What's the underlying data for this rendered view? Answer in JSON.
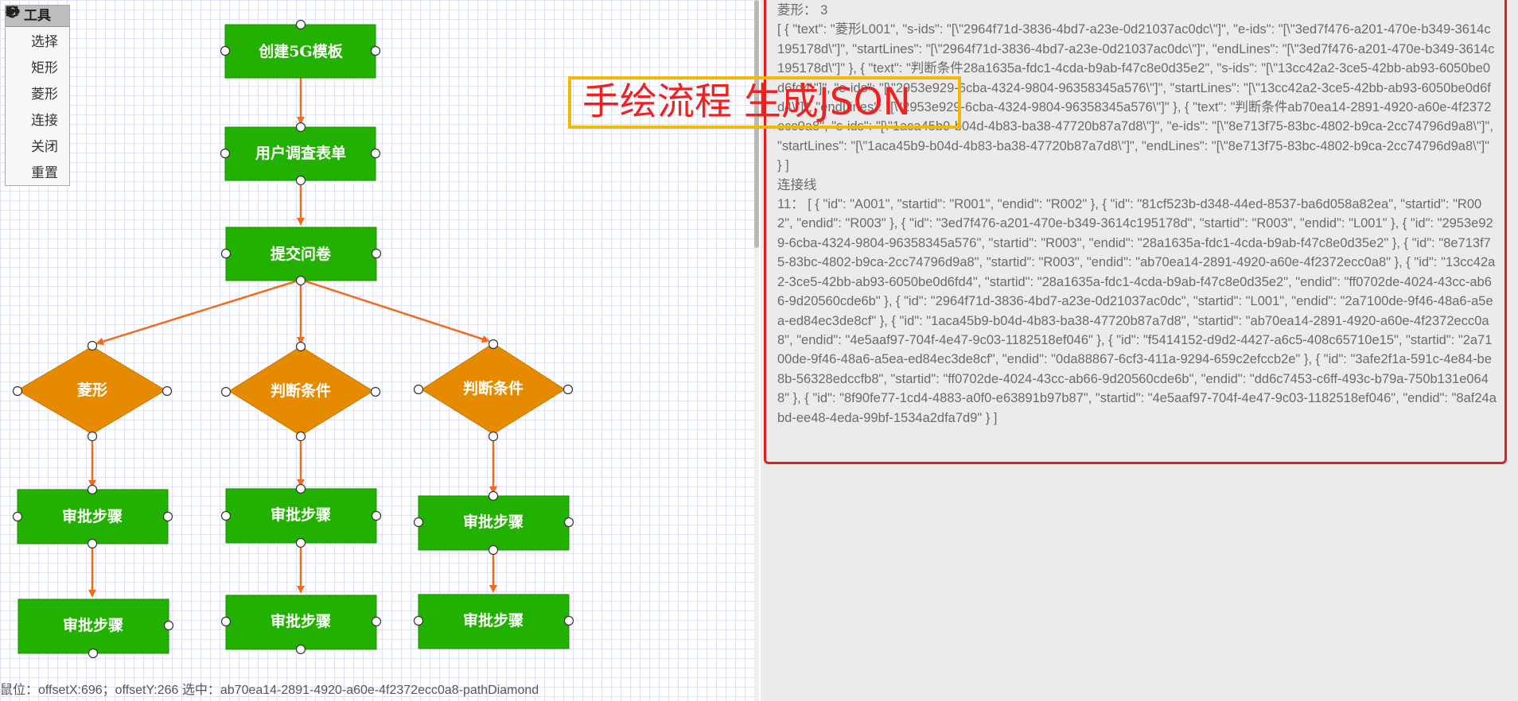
{
  "toolbox": {
    "title": "工具",
    "items": [
      {
        "icon": "pointer-icon",
        "label": "选择"
      },
      {
        "icon": "rectangle-icon",
        "label": "矩形"
      },
      {
        "icon": "diamond-icon",
        "label": "菱形"
      },
      {
        "icon": "arrow-right-icon",
        "label": "连接"
      },
      {
        "icon": "close-circle-icon",
        "label": "关闭"
      },
      {
        "icon": "undo-icon",
        "label": "重置"
      }
    ]
  },
  "flow": {
    "nodes": [
      {
        "id": "n1",
        "label": "创建5G模板"
      },
      {
        "id": "n2",
        "label": "用户调查表单"
      },
      {
        "id": "n3",
        "label": "提交问卷"
      },
      {
        "id": "d1",
        "label": "菱形"
      },
      {
        "id": "d2",
        "label": "判断条件"
      },
      {
        "id": "d3",
        "label": "判断条件"
      },
      {
        "id": "a1",
        "label": "审批步骤"
      },
      {
        "id": "a2",
        "label": "审批步骤"
      },
      {
        "id": "a3",
        "label": "审批步骤"
      },
      {
        "id": "a4",
        "label": "审批步骤"
      },
      {
        "id": "a5",
        "label": "审批步骤"
      },
      {
        "id": "a6",
        "label": "审批步骤"
      }
    ],
    "node_color": "#22b100",
    "diamond_color": "#e68a00",
    "edge_color": "#f26b1d"
  },
  "status_bar": {
    "text": "鼠位：offsetX:696；offsetY:266 选中：ab70ea14-2891-4920-a60e-4f2372ecc0a8-pathDiamond"
  },
  "annotation": {
    "text": "手绘流程   生成JSON"
  },
  "json_output": {
    "diamond_header": "菱形： 3",
    "diamond_json": "[ { \"text\": \"菱形L001\", \"s-ids\": \"[\\\"2964f71d-3836-4bd7-a23e-0d21037ac0dc\\\"]\", \"e-ids\": \"[\\\"3ed7f476-a201-470e-b349-3614c195178d\\\"]\", \"startLines\": \"[\\\"2964f71d-3836-4bd7-a23e-0d21037ac0dc\\\"]\", \"endLines\": \"[\\\"3ed7f476-a201-470e-b349-3614c195178d\\\"]\" }, { \"text\": \"判断条件28a1635a-fdc1-4cda-b9ab-f47c8e0d35e2\", \"s-ids\": \"[\\\"13cc42a2-3ce5-42bb-ab93-6050be0d6fd4\\\"]\", \"e-ids\": \"[\\\"2953e929-6cba-4324-9804-96358345a576\\\"]\", \"startLines\": \"[\\\"13cc42a2-3ce5-42bb-ab93-6050be0d6fd4\\\"]\", \"endLines\": \"[\\\"2953e929-6cba-4324-9804-96358345a576\\\"]\" }, { \"text\": \"判断条件ab70ea14-2891-4920-a60e-4f2372ecc0a8\", \"s-ids\": \"[\\\"1aca45b9-b04d-4b83-ba38-47720b87a7d8\\\"]\", \"e-ids\": \"[\\\"8e713f75-83bc-4802-b9ca-2cc74796d9a8\\\"]\", \"startLines\": \"[\\\"1aca45b9-b04d-4b83-ba38-47720b87a7d8\\\"]\", \"endLines\": \"[\\\"8e713f75-83bc-4802-b9ca-2cc74796d9a8\\\"]\" } ]",
    "line_header": "连接线",
    "line_json": "11： [ { \"id\": \"A001\", \"startid\": \"R001\", \"endid\": \"R002\" }, { \"id\": \"81cf523b-d348-44ed-8537-ba6d058a82ea\", \"startid\": \"R002\", \"endid\": \"R003\" }, { \"id\": \"3ed7f476-a201-470e-b349-3614c195178d\", \"startid\": \"R003\", \"endid\": \"L001\" }, { \"id\": \"2953e929-6cba-4324-9804-96358345a576\", \"startid\": \"R003\", \"endid\": \"28a1635a-fdc1-4cda-b9ab-f47c8e0d35e2\" }, { \"id\": \"8e713f75-83bc-4802-b9ca-2cc74796d9a8\", \"startid\": \"R003\", \"endid\": \"ab70ea14-2891-4920-a60e-4f2372ecc0a8\" }, { \"id\": \"13cc42a2-3ce5-42bb-ab93-6050be0d6fd4\", \"startid\": \"28a1635a-fdc1-4cda-b9ab-f47c8e0d35e2\", \"endid\": \"ff0702de-4024-43cc-ab66-9d20560cde6b\" }, { \"id\": \"2964f71d-3836-4bd7-a23e-0d21037ac0dc\", \"startid\": \"L001\", \"endid\": \"2a7100de-9f46-48a6-a5ea-ed84ec3de8cf\" }, { \"id\": \"1aca45b9-b04d-4b83-ba38-47720b87a7d8\", \"startid\": \"ab70ea14-2891-4920-a60e-4f2372ecc0a8\", \"endid\": \"4e5aaf97-704f-4e47-9c03-1182518ef046\" }, { \"id\": \"f5414152-d9d2-4427-a6c5-408c65710e15\", \"startid\": \"2a7100de-9f46-48a6-a5ea-ed84ec3de8cf\", \"endid\": \"0da88867-6cf3-411a-9294-659c2efccb2e\" }, { \"id\": \"3afe2f1a-591c-4e84-be8b-56328edccfb8\", \"startid\": \"ff0702de-4024-43cc-ab66-9d20560cde6b\", \"endid\": \"dd6c7453-c6ff-493c-b79a-750b131e0648\" }, { \"id\": \"8f90fe77-1cd4-4883-a0f0-e63891b97b87\", \"startid\": \"4e5aaf97-704f-4e47-9c03-1182518ef046\", \"endid\": \"8af24abd-ee48-4eda-99bf-1534a2dfa7d9\" } ]"
  }
}
